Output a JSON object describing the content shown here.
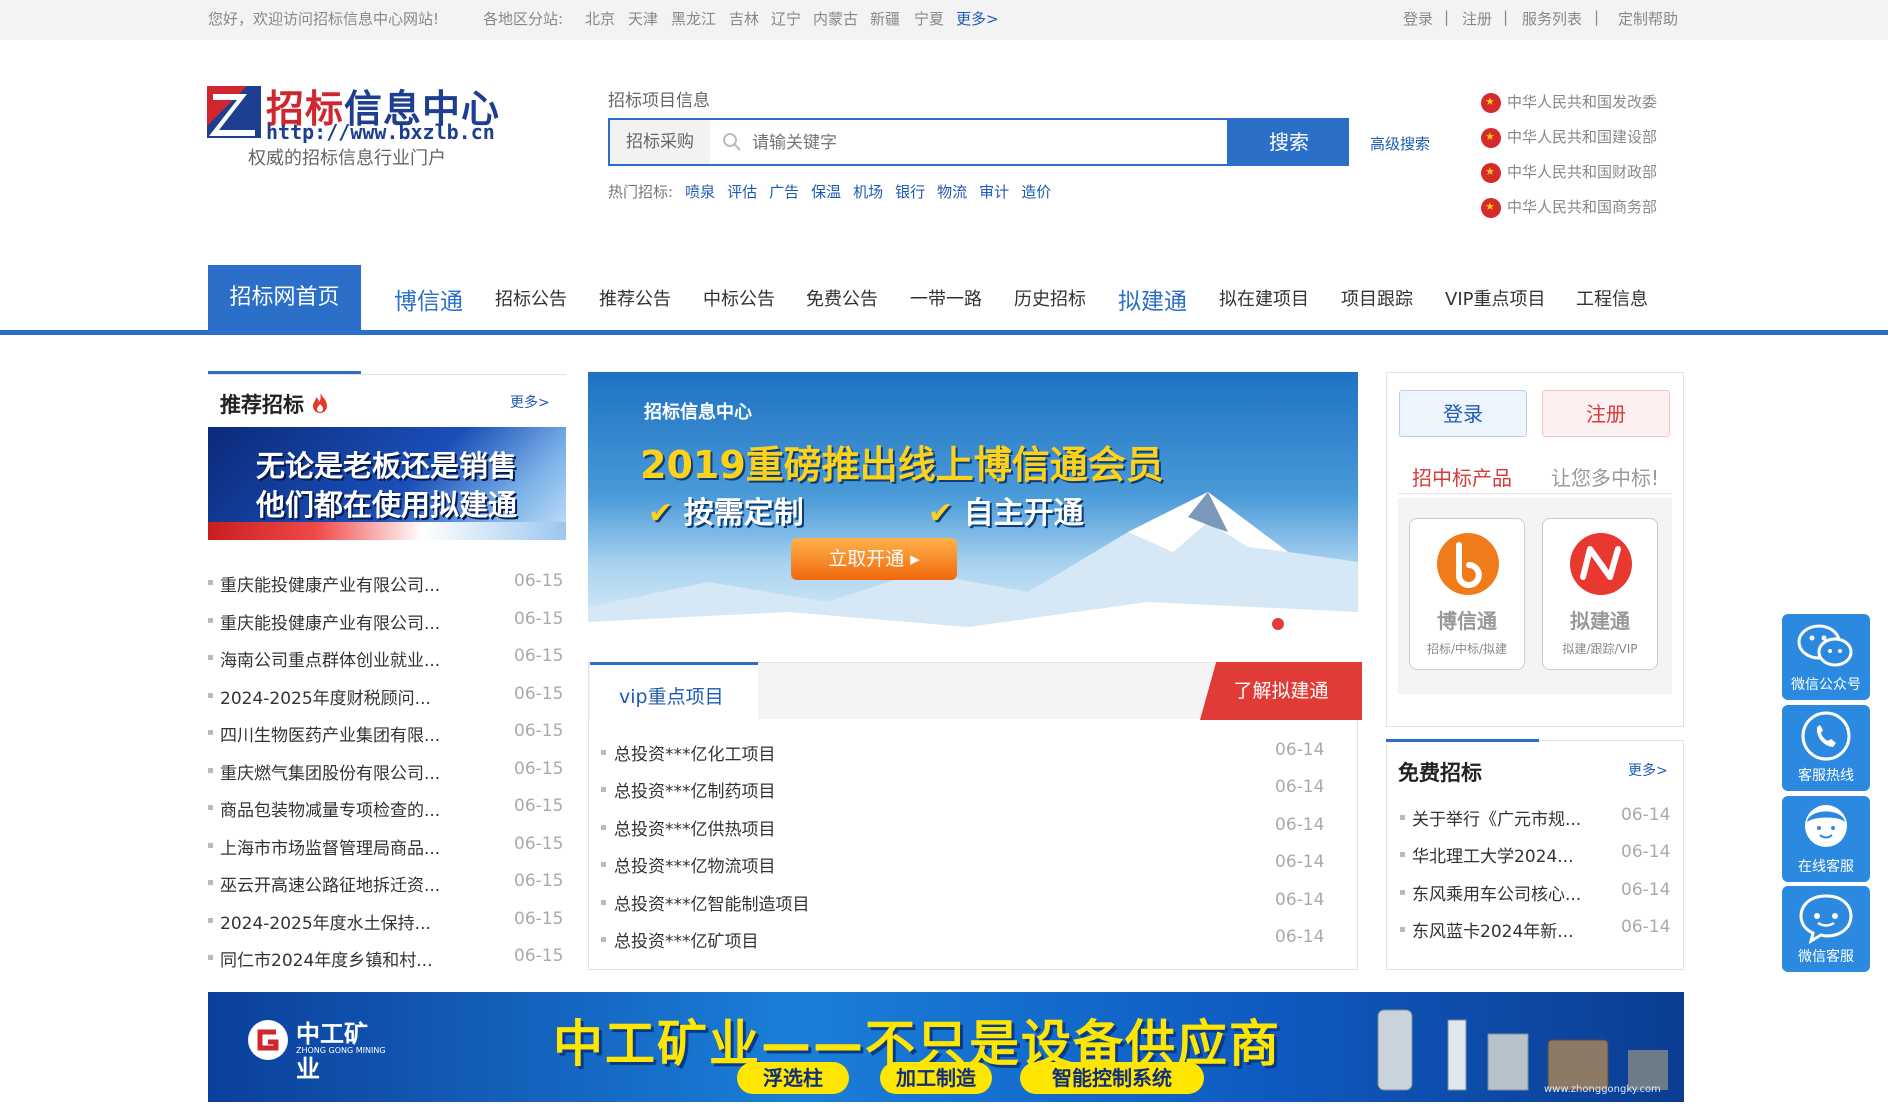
{
  "topbar": {
    "welcome": "您好，欢迎访问招标信息中心网站!",
    "regions_label": "各地区分站:",
    "regions": [
      "北京",
      "天津",
      "黑龙江",
      "吉林",
      "辽宁",
      "内蒙古",
      "新疆",
      "宁夏"
    ],
    "more": "更多>",
    "links": [
      "登录",
      "|",
      "注册",
      "|",
      "服务列表",
      "|",
      "定制帮助"
    ]
  },
  "header": {
    "logo_title_a": "招标",
    "logo_title_b": "信息中心",
    "logo_url": "http://www.bxzlb.cn",
    "slogan": "权威的招标信息行业门户",
    "search_label": "招标项目信息",
    "search_category": "招标采购",
    "search_placeholder": "请输关键字",
    "search_button": "搜索",
    "advanced_search": "高级搜索",
    "hot_label": "热门招标:",
    "hot_terms": [
      "喷泉",
      "评估",
      "广告",
      "保温",
      "机场",
      "银行",
      "物流",
      "审计",
      "造价"
    ],
    "gov_links": [
      "中华人民共和国发改委",
      "中华人民共和国建设部",
      "中华人民共和国财政部",
      "中华人民共和国商务部"
    ]
  },
  "nav": {
    "home": "招标网首页",
    "items": [
      "博信通",
      "招标公告",
      "推荐公告",
      "中标公告",
      "免费公告",
      "一带一路",
      "历史招标",
      "拟建通",
      "拟在建项目",
      "项目跟踪",
      "VIP重点项目",
      "工程信息"
    ]
  },
  "recommend": {
    "title": "推荐招标",
    "more": "更多>",
    "ad_line1": "无论是老板还是销售",
    "ad_line2": "他们都在使用拟建通",
    "rows": [
      {
        "title": "重庆能投健康产业有限公司...",
        "date": "06-15"
      },
      {
        "title": "重庆能投健康产业有限公司...",
        "date": "06-15"
      },
      {
        "title": "海南公司重点群体创业就业...",
        "date": "06-15"
      },
      {
        "title": "2024-2025年度财税顾问...",
        "date": "06-15"
      },
      {
        "title": "四川生物医药产业集团有限...",
        "date": "06-15"
      },
      {
        "title": "重庆燃气集团股份有限公司...",
        "date": "06-15"
      },
      {
        "title": "商品包装物减量专项检查的...",
        "date": "06-15"
      },
      {
        "title": "上海市市场监督管理局商品...",
        "date": "06-15"
      },
      {
        "title": "巫云开高速公路征地拆迁资...",
        "date": "06-15"
      },
      {
        "title": "2024-2025年度水土保持...",
        "date": "06-15"
      },
      {
        "title": "同仁市2024年度乡镇和村...",
        "date": "06-15"
      }
    ]
  },
  "center_banner": {
    "org": "招标信息中心",
    "headline": "2019重磅推出线上博信通会员",
    "feature1": "按需定制",
    "feature2": "自主开通",
    "cta": "立取开通",
    "cta_arrow": "▸"
  },
  "vip": {
    "title": "vip重点项目",
    "cta": "了解拟建通",
    "rows": [
      {
        "title": "总投资***亿化工项目",
        "date": "06-14"
      },
      {
        "title": "总投资***亿制药项目",
        "date": "06-14"
      },
      {
        "title": "总投资***亿供热项目",
        "date": "06-14"
      },
      {
        "title": "总投资***亿物流项目",
        "date": "06-14"
      },
      {
        "title": "总投资***亿智能制造项目",
        "date": "06-14"
      },
      {
        "title": "总投资***亿矿项目",
        "date": "06-14"
      }
    ]
  },
  "account": {
    "login": "登录",
    "register": "注册",
    "products_title": "招中标产品",
    "products_tagline": "让您多中标!",
    "products": [
      {
        "name": "博信通",
        "sub": "招标/中标/拟建",
        "color": "#f07b1a"
      },
      {
        "name": "拟建通",
        "sub": "拟建/跟踪/VIP",
        "color": "#e8382f"
      }
    ]
  },
  "free": {
    "title": "免费招标",
    "more": "更多>",
    "rows": [
      {
        "title": "关于举行《广元市规...",
        "date": "06-14"
      },
      {
        "title": "华北理工大学2024...",
        "date": "06-14"
      },
      {
        "title": "东风乘用车公司核心...",
        "date": "06-14"
      },
      {
        "title": "东风蓝卡2024年新...",
        "date": "06-14"
      }
    ]
  },
  "float_buttons": [
    "微信公众号",
    "客服热线",
    "在线客服",
    "微信客服"
  ],
  "bottom_banner": {
    "brand": "中工矿业",
    "brand_en": "ZHONG GONG MINING",
    "slogan": "中工矿业——不只是设备供应商",
    "tags": [
      "浮选柱",
      "加工制造",
      "智能控制系统"
    ],
    "url": "www.zhonggongky.com"
  }
}
